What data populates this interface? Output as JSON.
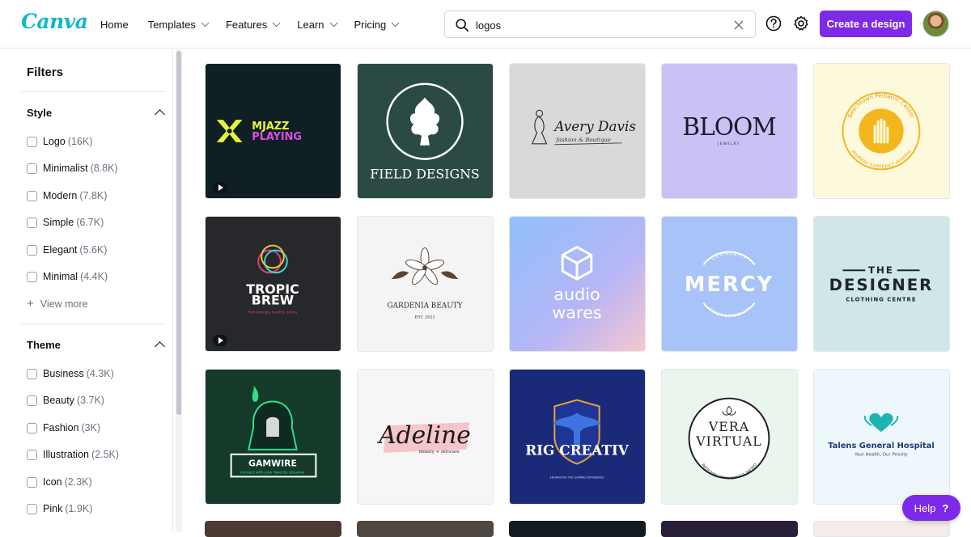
{
  "brand": "Canva",
  "nav": [
    {
      "label": "Home",
      "dropdown": false
    },
    {
      "label": "Templates",
      "dropdown": true
    },
    {
      "label": "Features",
      "dropdown": true
    },
    {
      "label": "Learn",
      "dropdown": true
    },
    {
      "label": "Pricing",
      "dropdown": true
    }
  ],
  "search": {
    "value": "logos",
    "icon": "search-icon",
    "clear_icon": "close-icon"
  },
  "header": {
    "help_icon": "question-circle-icon",
    "settings_icon": "gear-icon",
    "create_label": "Create a design",
    "accent": "#7d2ae8"
  },
  "sidebar": {
    "title": "Filters",
    "style": {
      "heading": "Style",
      "options": [
        {
          "label": "Logo",
          "count": "(16K)"
        },
        {
          "label": "Minimalist",
          "count": "(8.8K)"
        },
        {
          "label": "Modern",
          "count": "(7.8K)"
        },
        {
          "label": "Simple",
          "count": "(6.7K)"
        },
        {
          "label": "Elegant",
          "count": "(5.6K)"
        },
        {
          "label": "Minimal",
          "count": "(4.4K)"
        }
      ],
      "view_more": "View more"
    },
    "theme": {
      "heading": "Theme",
      "options": [
        {
          "label": "Business",
          "count": "(4.3K)"
        },
        {
          "label": "Beauty",
          "count": "(3.7K)"
        },
        {
          "label": "Fashion",
          "count": "(3K)"
        },
        {
          "label": "Illustration",
          "count": "(2.5K)"
        },
        {
          "label": "Icon",
          "count": "(2.3K)"
        },
        {
          "label": "Pink",
          "count": "(1.9K)"
        }
      ]
    }
  },
  "templates": [
    {
      "text": [
        "MJAZZ",
        "PLAYING"
      ],
      "bg": "#0f1f24",
      "video": true
    },
    {
      "text": [
        "FIELD DESIGNS"
      ],
      "bg": "#2c4a44",
      "video": false
    },
    {
      "text": [
        "Avery Davis",
        "fashion & Boutique"
      ],
      "bg": "#d9d9d9",
      "video": false
    },
    {
      "text": [
        "BLOOM",
        "JEWELRY"
      ],
      "bg": "#c9c3f5",
      "video": false
    },
    {
      "text": [
        "Beechtown Pediatric Center",
        "Premier Children's Hospital"
      ],
      "bg": "#fdf9dc",
      "video": false
    },
    {
      "text": [
        "TROPIC",
        "BREW",
        "Refreshingly healthy drinks"
      ],
      "bg": "#26282b",
      "video": true
    },
    {
      "text": [
        "GARDENIA BEAUTY",
        "EST. 2021"
      ],
      "bg": "#f4f4f4",
      "video": false
    },
    {
      "text": [
        "audio",
        "wares"
      ],
      "bg": "#a9c6f8",
      "video": false
    },
    {
      "text": [
        "MERCY",
        "COMMUNITY",
        "OF BELIEVERS"
      ],
      "bg": "#a7c3f7",
      "video": false
    },
    {
      "text": [
        "THE",
        "DESIGNER",
        "CLOTHING CENTRE"
      ],
      "bg": "#cfe7e8",
      "video": false
    },
    {
      "text": [
        "GAMWIRE",
        "connect with your favorite streamer"
      ],
      "bg": "#163a2a",
      "video": false
    },
    {
      "text": [
        "Adeline",
        "beauty + skincare"
      ],
      "bg": "#f6f6f6",
      "video": false
    },
    {
      "text": [
        "RIG CREATIV",
        "ENHANCING THE GAMING EXPERIENCE"
      ],
      "bg": "#1b2a78",
      "video": false
    },
    {
      "text": [
        "VERA",
        "VIRTUAL",
        "ONLINE EVENTS MADE AWESOME"
      ],
      "bg": "#eaf5ee",
      "video": false
    },
    {
      "text": [
        "Talens General Hospital",
        "Your Health, Our Priority"
      ],
      "bg": "#eef7fb",
      "video": false
    }
  ],
  "help": {
    "label": "Help",
    "icon": "?"
  }
}
